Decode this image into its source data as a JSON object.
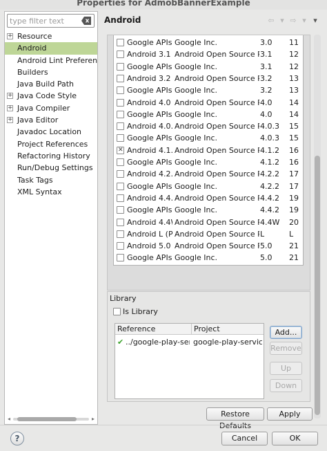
{
  "window": {
    "title": "Properties for AdmobBannerExample"
  },
  "filter": {
    "placeholder": "type filter text",
    "value": ""
  },
  "sidebar": {
    "items": [
      {
        "label": "Resource",
        "expandable": true,
        "selected": false
      },
      {
        "label": "Android",
        "expandable": false,
        "selected": true
      },
      {
        "label": "Android Lint Preference",
        "expandable": false,
        "selected": false
      },
      {
        "label": "Builders",
        "expandable": false,
        "selected": false
      },
      {
        "label": "Java Build Path",
        "expandable": false,
        "selected": false
      },
      {
        "label": "Java Code Style",
        "expandable": true,
        "selected": false
      },
      {
        "label": "Java Compiler",
        "expandable": true,
        "selected": false
      },
      {
        "label": "Java Editor",
        "expandable": true,
        "selected": false
      },
      {
        "label": "Javadoc Location",
        "expandable": false,
        "selected": false
      },
      {
        "label": "Project References",
        "expandable": false,
        "selected": false
      },
      {
        "label": "Refactoring History",
        "expandable": false,
        "selected": false
      },
      {
        "label": "Run/Debug Settings",
        "expandable": false,
        "selected": false
      },
      {
        "label": "Task Tags",
        "expandable": false,
        "selected": false
      },
      {
        "label": "XML Syntax",
        "expandable": false,
        "selected": false
      }
    ]
  },
  "page": {
    "title": "Android"
  },
  "targets": [
    {
      "name": "Google APIs",
      "vendor": "Google Inc.",
      "platform": "3.0",
      "api": "11",
      "checked": false
    },
    {
      "name": "Android 3.1",
      "vendor": "Android Open Source Project",
      "platform": "3.1",
      "api": "12",
      "checked": false
    },
    {
      "name": "Google APIs",
      "vendor": "Google Inc.",
      "platform": "3.1",
      "api": "12",
      "checked": false
    },
    {
      "name": "Android 3.2",
      "vendor": "Android Open Source Project",
      "platform": "3.2",
      "api": "13",
      "checked": false
    },
    {
      "name": "Google APIs",
      "vendor": "Google Inc.",
      "platform": "3.2",
      "api": "13",
      "checked": false
    },
    {
      "name": "Android 4.0",
      "vendor": "Android Open Source Project",
      "platform": "4.0",
      "api": "14",
      "checked": false
    },
    {
      "name": "Google APIs",
      "vendor": "Google Inc.",
      "platform": "4.0",
      "api": "14",
      "checked": false
    },
    {
      "name": "Android 4.0.3",
      "vendor": "Android Open Source Project",
      "platform": "4.0.3",
      "api": "15",
      "checked": false
    },
    {
      "name": "Google APIs",
      "vendor": "Google Inc.",
      "platform": "4.0.3",
      "api": "15",
      "checked": false
    },
    {
      "name": "Android 4.1.2",
      "vendor": "Android Open Source Project",
      "platform": "4.1.2",
      "api": "16",
      "checked": true
    },
    {
      "name": "Google APIs",
      "vendor": "Google Inc.",
      "platform": "4.1.2",
      "api": "16",
      "checked": false
    },
    {
      "name": "Android 4.2.2",
      "vendor": "Android Open Source Project",
      "platform": "4.2.2",
      "api": "17",
      "checked": false
    },
    {
      "name": "Google APIs",
      "vendor": "Google Inc.",
      "platform": "4.2.2",
      "api": "17",
      "checked": false
    },
    {
      "name": "Android 4.4.2",
      "vendor": "Android Open Source Project",
      "platform": "4.4.2",
      "api": "19",
      "checked": false
    },
    {
      "name": "Google APIs",
      "vendor": "Google Inc.",
      "platform": "4.4.2",
      "api": "19",
      "checked": false
    },
    {
      "name": "Android 4.4W",
      "vendor": "Android Open Source Project",
      "platform": "4.4W",
      "api": "20",
      "checked": false
    },
    {
      "name": "Android L (Preview)",
      "vendor": "Android Open Source Project",
      "platform": "L",
      "api": "L",
      "checked": false
    },
    {
      "name": "Android 5.0",
      "vendor": "Android Open Source Project",
      "platform": "5.0",
      "api": "21",
      "checked": false
    },
    {
      "name": "Google APIs",
      "vendor": "Google Inc.",
      "platform": "5.0",
      "api": "21",
      "checked": false
    }
  ],
  "library": {
    "legend": "Library",
    "is_library_label": "Is Library",
    "is_library_checked": false,
    "columns": {
      "reference": "Reference",
      "project": "Project"
    },
    "rows": [
      {
        "reference": "../google-play-services_lib",
        "project": "google-play-services_lib",
        "status_icon": "check-icon"
      }
    ],
    "buttons": {
      "add": "Add...",
      "remove": "Remove",
      "up": "Up",
      "down": "Down"
    }
  },
  "footer": {
    "restore_defaults": "Restore Defaults",
    "apply": "Apply",
    "cancel": "Cancel",
    "ok": "OK",
    "help": "?"
  },
  "colors": {
    "selection": "#bed697",
    "check": "#3aa12a"
  }
}
